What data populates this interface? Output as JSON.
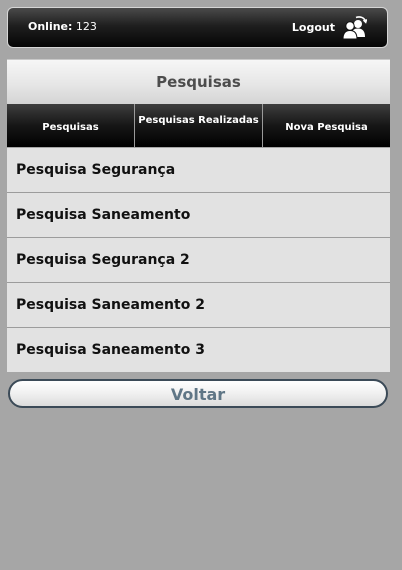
{
  "header": {
    "online_label": "Online:",
    "online_count": "123",
    "logout_label": "Logout",
    "logout_icon": "users-icon"
  },
  "page": {
    "title": "Pesquisas"
  },
  "tabs": [
    {
      "label": "Pesquisas"
    },
    {
      "label": "Pesquisas Realizadas"
    },
    {
      "label": "Nova Pesquisa"
    }
  ],
  "surveys": [
    {
      "label": "Pesquisa Segurança"
    },
    {
      "label": "Pesquisa Saneamento"
    },
    {
      "label": "Pesquisa Segurança 2"
    },
    {
      "label": "Pesquisa Saneamento 2"
    },
    {
      "label": "Pesquisa Saneamento 3"
    }
  ],
  "footer": {
    "back_label": "Voltar"
  },
  "colors": {
    "background": "#a6a6a6",
    "list_bg": "#e2e2e2",
    "back_text": "#5f7686"
  }
}
